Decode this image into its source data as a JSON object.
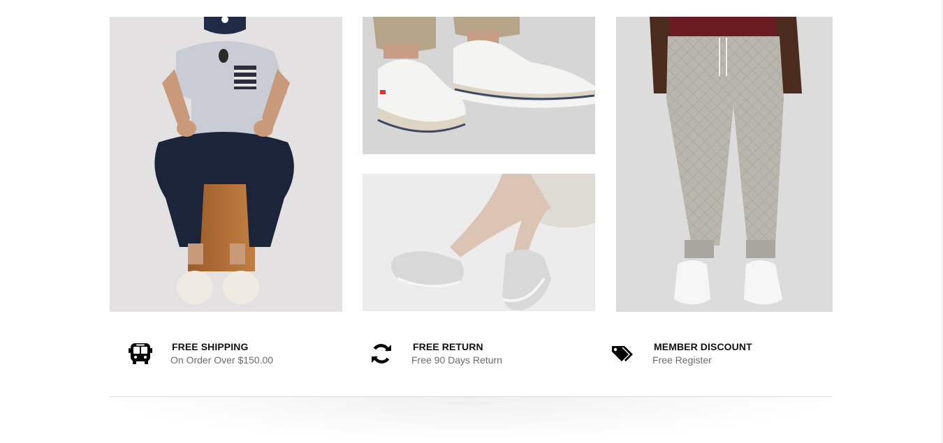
{
  "banners": [
    {
      "name": "banner-man-sitting",
      "icon": "photo-man-sitting-on-stool"
    },
    {
      "name": "banner-shoes-closeup",
      "icon": "photo-white-sneakers-closeup"
    },
    {
      "name": "banner-woman-sneakers",
      "icon": "photo-woman-grey-sneakers"
    },
    {
      "name": "banner-joggers",
      "icon": "photo-grey-quilted-joggers"
    }
  ],
  "services": [
    {
      "title": "FREE SHIPPING",
      "subtitle": "On Order Over $150.00",
      "icon": "bus-icon"
    },
    {
      "title": "FREE RETURN",
      "subtitle": "Free 90 Days Return",
      "icon": "refresh-icon"
    },
    {
      "title": "MEMBER DISCOUNT",
      "subtitle": "Free Register",
      "icon": "tags-icon"
    }
  ],
  "colors": {
    "title": "#111111",
    "subtitle": "#6b6b6b",
    "divider": "#dcdcdc"
  }
}
